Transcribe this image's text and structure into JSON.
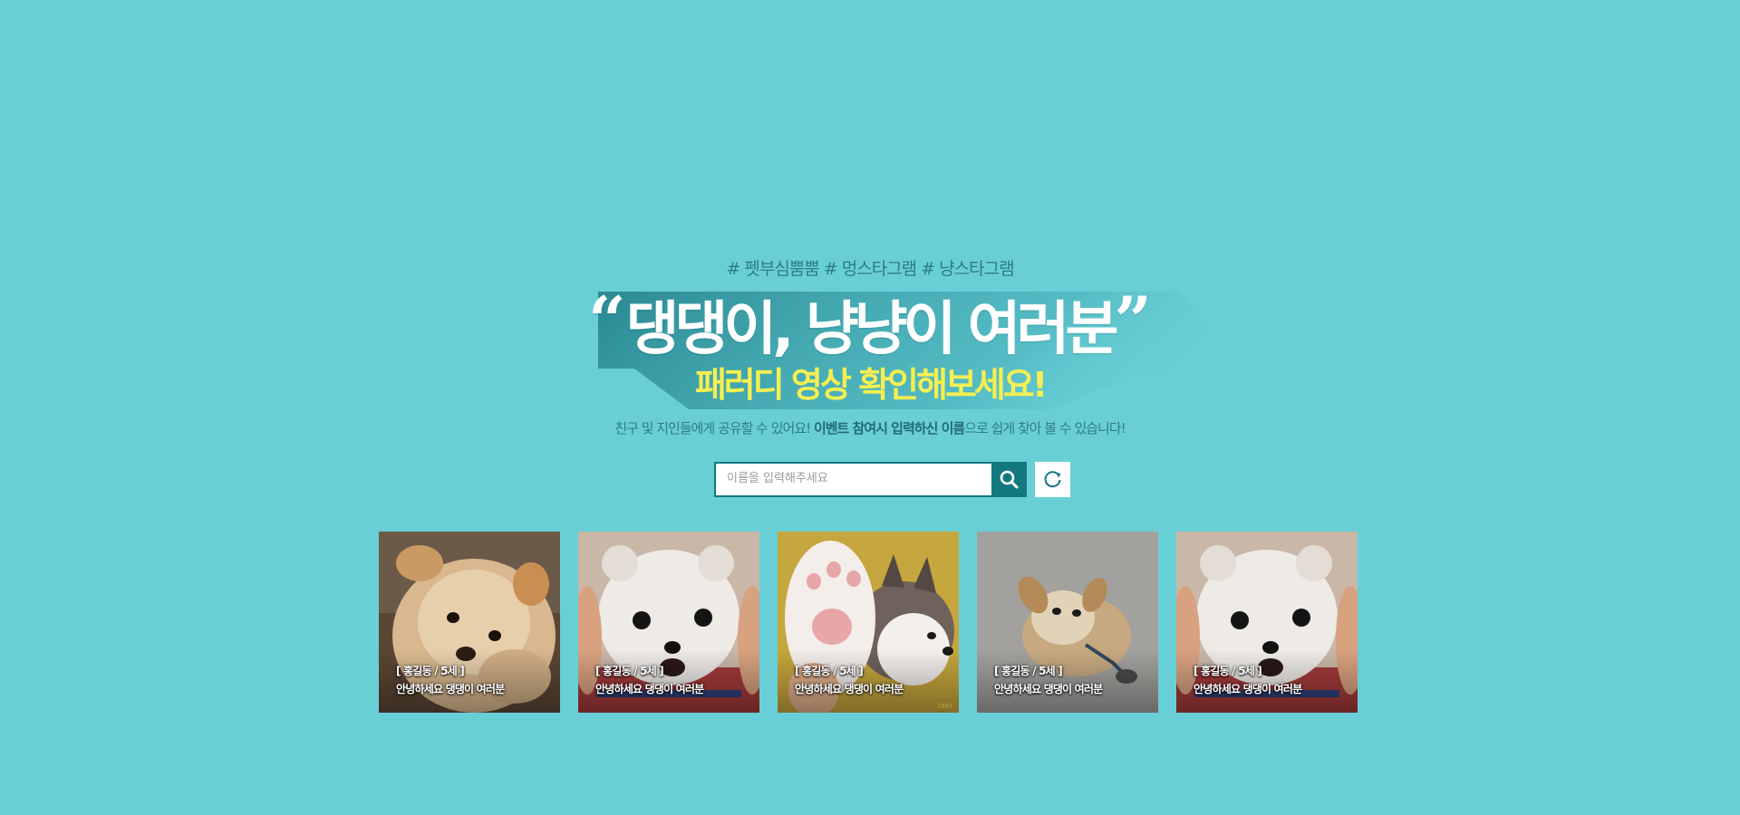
{
  "hero": {
    "hashtags": "# 펫부심뿜뿜 # 멍스타그램 # 냥스타그램",
    "quote_open": "“",
    "title": "댕댕이, 냥냥이 여러분",
    "quote_close": "”",
    "subtitle": "패러디 영상 확인해보세요!",
    "description_start": "친구 및 지인들에게 공유할 수 있어요! ",
    "description_bold": "이벤트 참여시 입력하신 이름",
    "description_end": "으로 쉽게 찾아 볼 수 있습니다!"
  },
  "search": {
    "placeholder": "이름을 입력해주세요",
    "value": "",
    "search_icon": "search-icon",
    "refresh_icon": "refresh-icon"
  },
  "colors": {
    "background": "#69cfd7",
    "accent_dark": "#137980",
    "subtitle_yellow": "#f5ef52",
    "title_white": "#ffffff"
  },
  "gallery": {
    "items": [
      {
        "meta": "[ 홍길동 / 5세 ]",
        "caption": "안녕하세요 댕댕이 여러분",
        "photo": "fluffy cream puppy"
      },
      {
        "meta": "[ 홍길동 / 5세 ]",
        "caption": "안녕하세요 댕댕이 여러분",
        "photo": "white pomeranian puppy held in hands"
      },
      {
        "meta": "[ 홍길동 / 5세 ]",
        "caption": "안녕하세요 댕댕이 여러분",
        "photo": "husky puppy with raised paw"
      },
      {
        "meta": "[ 홍길동 / 5세 ]",
        "caption": "안녕하세요 댕댕이 여러분",
        "photo": "dog lying on back waving paws"
      },
      {
        "meta": "[ 홍길동 / 5세 ]",
        "caption": "안녕하세요 댕댕이 여러분",
        "photo": "white pomeranian puppy held in hands"
      }
    ]
  }
}
